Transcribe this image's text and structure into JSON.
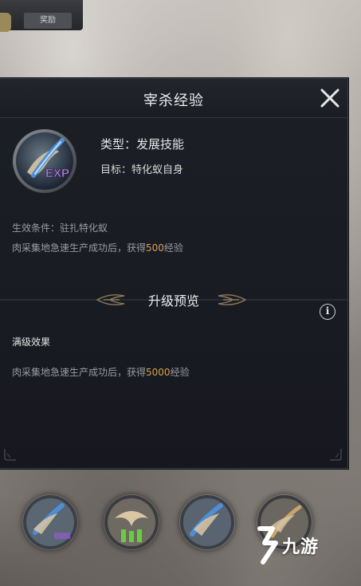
{
  "top_chip": {
    "button_label": "奖励"
  },
  "panel": {
    "title": "宰杀经验",
    "skill_icon_label": "EXP",
    "type_label": "类型：",
    "type_value": "发展技能",
    "target_label": "目标：",
    "target_value": "特化蚁自身",
    "condition_label": "生效条件：",
    "condition_value": "驻扎特化蚁",
    "effect_prefix": "肉采集地急速生产成功后，获得",
    "effect_value": "500",
    "effect_suffix": "经验",
    "upgrade_title": "升级预览",
    "info_icon_glyph": "i",
    "max_level_label": "满级效果",
    "max_effect_prefix": "肉采集地急速生产成功后，获得",
    "max_effect_value": "5000",
    "max_effect_suffix": "经验"
  },
  "watermark": {
    "text": "九游"
  },
  "colors": {
    "accent_gold": "#d4a24c",
    "panel_bg": "#1b1d24",
    "muted_text": "#9a9ba3"
  },
  "icons": [
    "close-icon",
    "exp-skill-icon",
    "info-icon",
    "wing-ornament-icon"
  ]
}
